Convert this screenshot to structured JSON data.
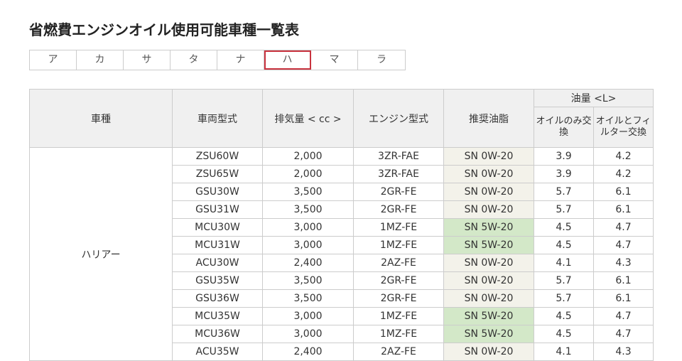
{
  "title": "省燃費エンジンオイル使用可能車種一覧表",
  "tabs": [
    "ア",
    "カ",
    "サ",
    "タ",
    "ナ",
    "ハ",
    "マ",
    "ラ"
  ],
  "active_tab": "ハ",
  "colors": {
    "accent": "#c9333f",
    "header_bg": "#f0f0f0",
    "oil_0w_bg": "#f3f2ea",
    "oil_5w_bg": "#d3e8c8"
  },
  "table": {
    "headers": {
      "model": "車種",
      "type": "車両型式",
      "displacement": "排気量 < cc >",
      "engine": "エンジン型式",
      "oil": "推奨油脂",
      "capacity": "油量 <L>",
      "oil_only": "オイルのみ交換",
      "oil_filter": "オイルとフィルター交換"
    },
    "model_name": "ハリアー",
    "rows": [
      [
        "ZSU60W",
        "2,000",
        "3ZR-FAE",
        "SN 0W-20",
        "3.9",
        "4.2"
      ],
      [
        "ZSU65W",
        "2,000",
        "3ZR-FAE",
        "SN 0W-20",
        "3.9",
        "4.2"
      ],
      [
        "GSU30W",
        "3,500",
        "2GR-FE",
        "SN 0W-20",
        "5.7",
        "6.1"
      ],
      [
        "GSU31W",
        "3,500",
        "2GR-FE",
        "SN 0W-20",
        "5.7",
        "6.1"
      ],
      [
        "MCU30W",
        "3,000",
        "1MZ-FE",
        "SN 5W-20",
        "4.5",
        "4.7"
      ],
      [
        "MCU31W",
        "3,000",
        "1MZ-FE",
        "SN 5W-20",
        "4.5",
        "4.7"
      ],
      [
        "ACU30W",
        "2,400",
        "2AZ-FE",
        "SN 0W-20",
        "4.1",
        "4.3"
      ],
      [
        "GSU35W",
        "3,500",
        "2GR-FE",
        "SN 0W-20",
        "5.7",
        "6.1"
      ],
      [
        "GSU36W",
        "3,500",
        "2GR-FE",
        "SN 0W-20",
        "5.7",
        "6.1"
      ],
      [
        "MCU35W",
        "3,000",
        "1MZ-FE",
        "SN 5W-20",
        "4.5",
        "4.7"
      ],
      [
        "MCU36W",
        "3,000",
        "1MZ-FE",
        "SN 5W-20",
        "4.5",
        "4.7"
      ],
      [
        "ACU35W",
        "2,400",
        "2AZ-FE",
        "SN 0W-20",
        "4.1",
        "4.3"
      ]
    ]
  }
}
